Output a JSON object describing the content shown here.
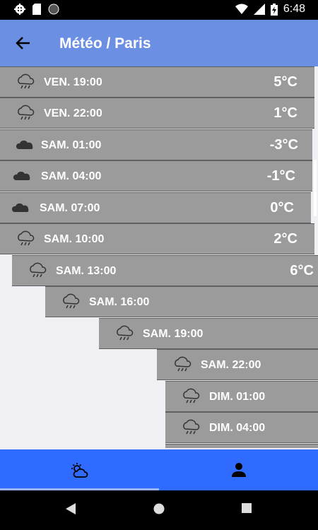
{
  "status_bar": {
    "time": "6:48"
  },
  "app_bar": {
    "title": "Météo / Paris"
  },
  "forecast": [
    {
      "time": "VEN. 19:00",
      "temp": "5°C",
      "icon": "rain-cloud-icon"
    },
    {
      "time": "VEN. 22:00",
      "temp": "1°C",
      "icon": "rain-cloud-icon"
    },
    {
      "time": "SAM. 01:00",
      "temp": "-3°C",
      "icon": "cloudy-icon"
    },
    {
      "time": "SAM. 04:00",
      "temp": "-1°C",
      "icon": "cloudy-icon"
    },
    {
      "time": "SAM. 07:00",
      "temp": "0°C",
      "icon": "cloudy-icon"
    },
    {
      "time": "SAM. 10:00",
      "temp": "2°C",
      "icon": "rain-cloud-icon"
    },
    {
      "time": "SAM. 13:00",
      "temp": "6°C",
      "icon": "rain-cloud-icon"
    },
    {
      "time": "SAM. 16:00",
      "temp": "",
      "icon": "rain-cloud-icon"
    },
    {
      "time": "SAM. 19:00",
      "temp": "",
      "icon": "rain-cloud-icon"
    },
    {
      "time": "SAM. 22:00",
      "temp": "",
      "icon": "rain-cloud-icon"
    },
    {
      "time": "DIM. 01:00",
      "temp": "",
      "icon": "rain-cloud-icon"
    },
    {
      "time": "DIM. 04:00",
      "temp": "",
      "icon": "rain-cloud-icon"
    }
  ],
  "bottom_nav": {
    "tabs": [
      {
        "icon": "weather-icon"
      },
      {
        "icon": "profile-icon"
      }
    ]
  },
  "colors": {
    "app_bar": "#6b8fe3",
    "row_bg": "#9b9b9b",
    "bottom_nav": "#2f6bff"
  }
}
